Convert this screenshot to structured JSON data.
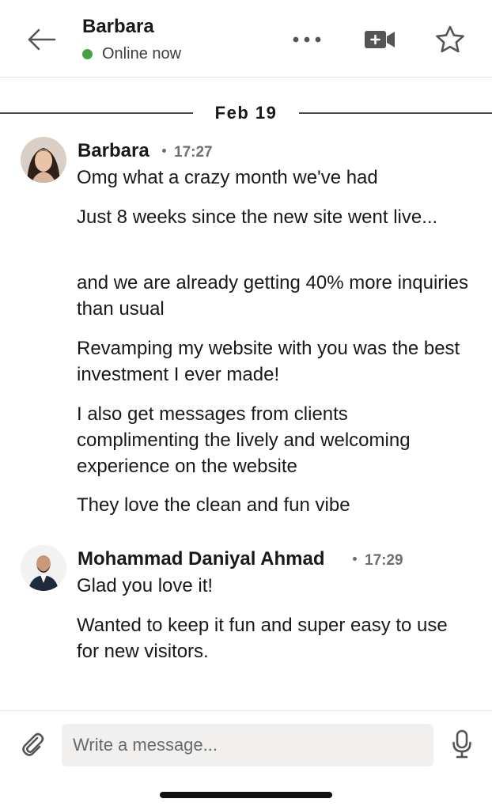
{
  "header": {
    "contact_name": "Barbara",
    "status": "Online now",
    "status_color": "#44a244",
    "icons": {
      "back": "back-arrow-icon",
      "more": "more-dots-icon",
      "video": "video-call-icon",
      "star": "star-icon"
    }
  },
  "date_separator": "Feb 19",
  "threads": [
    {
      "author": "Barbara",
      "time": "17:27",
      "messages": [
        "Omg what a crazy month we've had",
        "Just 8 weeks since the new site went live...",
        "and we are already getting 40% more inquiries than usual",
        "Revamping my website with you was the best investment I ever made!",
        "I also get messages from clients complimenting the lively and welcoming experience on the website",
        "They love the clean and fun vibe"
      ]
    },
    {
      "author": "Mohammad Daniyal Ahmad",
      "time": "17:29",
      "messages": [
        "Glad you love it!",
        "Wanted to keep it fun and super easy to use for new visitors."
      ]
    }
  ],
  "composer": {
    "placeholder": "Write a message...",
    "icons": {
      "attach": "paperclip-icon",
      "mic": "microphone-icon"
    }
  }
}
